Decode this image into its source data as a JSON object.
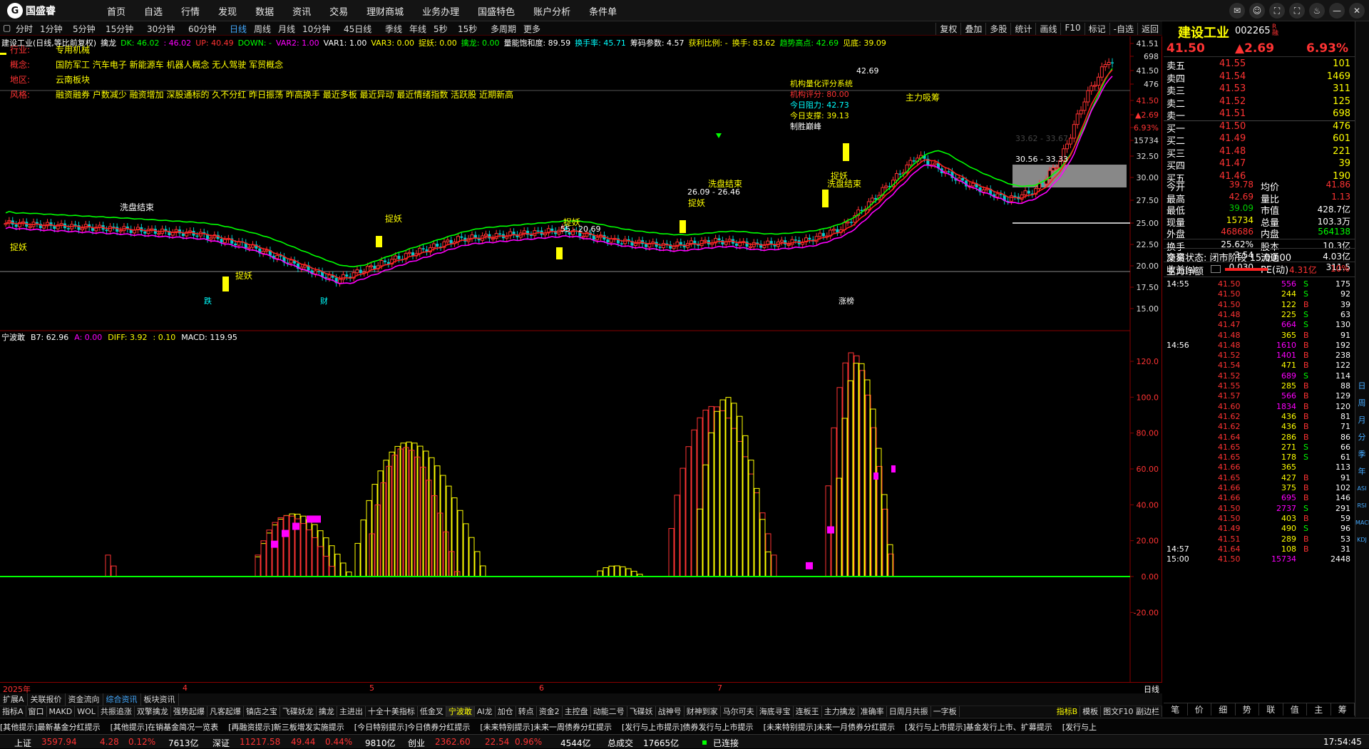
{
  "app": {
    "name": "国盛睿",
    "menu": [
      "首页",
      "自选",
      "行情",
      "发现",
      "数据",
      "资讯",
      "交易",
      "理财商城",
      "业务办理",
      "国盛特色",
      "账户分析",
      "条件单"
    ]
  },
  "window_icons": [
    "message-icon",
    "user-icon",
    "fullscreen-icon",
    "fullscreen-icon",
    "skin-icon",
    "minimize-icon",
    "close-icon"
  ],
  "periods": [
    "分时",
    "1分钟",
    "5分钟",
    "15分钟",
    "30分钟",
    "60分钟",
    "日线",
    "周线",
    "月线",
    "10分钟",
    "45日线",
    "季线",
    "年线",
    "5秒",
    "15秒",
    "多周期",
    "更多"
  ],
  "active_period": "日线",
  "tools": [
    "复权",
    "叠加",
    "多股",
    "统计",
    "画线",
    "F10",
    "标记",
    "-自选",
    "返回"
  ],
  "ind1": [
    {
      "t": "建设工业(日线,等比前复权)",
      "c": "#fff"
    },
    {
      "t": "擒龙",
      "c": "#fff"
    },
    {
      "t": "DK: 46.02",
      "c": "#0f0"
    },
    {
      "t": ": 46.02",
      "c": "#f0f"
    },
    {
      "t": "UP: 40.49",
      "c": "#f33"
    },
    {
      "t": "DOWN: -",
      "c": "#0f0"
    },
    {
      "t": "VAR2: 1.00",
      "c": "#f0f"
    },
    {
      "t": "VAR1: 1.00",
      "c": "#fff"
    },
    {
      "t": "VAR3: 0.00",
      "c": "#ff0"
    },
    {
      "t": "捉妖: 0.00",
      "c": "#ff0"
    },
    {
      "t": "擒龙: 0.00",
      "c": "#0f0"
    },
    {
      "t": "量能饱和度: 89.59",
      "c": "#fff"
    },
    {
      "t": "换手率: 45.71",
      "c": "#0ff"
    },
    {
      "t": "筹码参数: 4.57",
      "c": "#fff"
    },
    {
      "t": "获利比例: -",
      "c": "#ff0"
    },
    {
      "t": "换手: 83.62",
      "c": "#ff0"
    },
    {
      "t": "趋势高点: 42.69",
      "c": "#0f0"
    },
    {
      "t": "见底: 39.09",
      "c": "#ff0"
    }
  ],
  "info": [
    {
      "k": "行业:",
      "v": "专用机械"
    },
    {
      "k": "概念:",
      "v": "国防军工 汽车电子 新能源车 机器人概念 无人驾驶 军贸概念"
    },
    {
      "k": "地区:",
      "v": "云南板块"
    },
    {
      "k": "风格:",
      "v": "融资融券 户数减少 融资增加 深股通标的 久不分红 昨日振荡 昨高换手 最近多板 最近异动 最近情绪指数 活跃股 近期新高"
    }
  ],
  "eval": {
    "title": "机构量化评分系统",
    "score_label": "机构评分: 80.00",
    "resist_label": "今日阻力: 42.73",
    "support_label": "今日支撑: 39.13",
    "peak_label": "制胜巅峰"
  },
  "price_axis": [
    "41.51",
    "698",
    "41.50",
    "476",
    "41.50",
    "▲2.69",
    "6.93%",
    "15734",
    "32.50",
    "30.00",
    "27.50",
    "25.00",
    "22.50",
    "20.00",
    "17.50",
    "15.00"
  ],
  "macd_axis": [
    "120.0",
    "100.0",
    "80.00",
    "60.00",
    "40.00",
    "20.00",
    "0.00",
    "-20.00"
  ],
  "chart_labels": {
    "zhuoyao": "捉妖",
    "xipan": "洗盘结束",
    "zhuli": "主力吸筹",
    "die": "跌",
    "cai": "财",
    "zhangting": "涨榜",
    "rng1": "33.62 - 33.67",
    "rng2": "30.56 - 33.33",
    "rng3": "26.09 - 26.46",
    "rng4": "55 - 20.69",
    "hi": "42.69"
  },
  "ind2": [
    {
      "t": "宁波敢",
      "c": "#fff"
    },
    {
      "t": "B7: 62.96",
      "c": "#fff"
    },
    {
      "t": "A: 0.00",
      "c": "#f0f"
    },
    {
      "t": "DIFF: 3.92",
      "c": "#ff0"
    },
    {
      "t": ": 0.10",
      "c": "#ff0"
    },
    {
      "t": "MACD: 119.95",
      "c": "#fff"
    }
  ],
  "xaxis": [
    "2025年",
    "4",
    "5",
    "6",
    "7"
  ],
  "tabsA": [
    "扩展A",
    "关联报价",
    "资金流向",
    "综合资讯",
    "板块资讯"
  ],
  "tabsA_active": "综合资讯",
  "tabsB": [
    "指标A",
    "窗口",
    "MAKD",
    "WOL",
    "共振追涨",
    "双擎擒龙",
    "强势起爆",
    "凡客起爆",
    "镇店之宝",
    "飞碟妖龙",
    "擒龙",
    "主进出",
    "十全十美指标",
    "低金叉",
    "宁波敢",
    "AI龙",
    "加仓",
    "转点",
    "资金2",
    "主控盘",
    "动能二号",
    "飞碟妖",
    "战神号",
    "财神到家",
    "马尔可夫",
    "海底寻宝",
    "连板王",
    "主力擒龙",
    "准确率",
    "日周月共振",
    "一字板"
  ],
  "tabsB_active": "宁波敢",
  "tabsB_right": [
    "指标B",
    "模板",
    "图文F10 副边栏"
  ],
  "ticker": [
    "[其他提示]最新基金分红提示",
    "[其他提示]在销基金简况一览表",
    "[再融资提示]新三板增发实施提示",
    "[今日特别提示]今日债券分红提示",
    "[未来特别提示]未来一周债券分红提示",
    "[发行与上市提示]债券发行与上市提示",
    "[未来特别提示]未来一月债券分红提示",
    "[发行与上市提示]基金发行上市、扩募提示",
    "[发行与上"
  ],
  "status": {
    "sh_label": "上证",
    "sh_val": "3597.94",
    "sh_chg": "4.28",
    "sh_pct": "0.12%",
    "sh_amt": "7613亿",
    "sz_label": "深证",
    "sz_val": "11217.58",
    "sz_chg": "49.44",
    "sz_pct": "0.44%",
    "sz_amt": "9810亿",
    "cy_label": "创业",
    "cy_val": "2362.60",
    "cy_chg": "22.54",
    "cy_pct": "0.96%",
    "cy_amt": "4544亿",
    "total_label": "总成交",
    "total_amt": "17665亿",
    "conn": "已连接",
    "time": "17:54:45"
  },
  "quote": {
    "name": "建设工业",
    "code": "002265",
    "price": "41.50",
    "change": "▲2.69",
    "pct": "6.93%",
    "asks": [
      [
        "卖五",
        "41.55",
        "101"
      ],
      [
        "卖四",
        "41.54",
        "1469"
      ],
      [
        "卖三",
        "41.53",
        "311"
      ],
      [
        "卖二",
        "41.52",
        "125"
      ],
      [
        "卖一",
        "41.51",
        "698"
      ]
    ],
    "bids": [
      [
        "买一",
        "41.50",
        "476"
      ],
      [
        "买二",
        "41.49",
        "601"
      ],
      [
        "买三",
        "41.48",
        "221"
      ],
      [
        "买四",
        "41.47",
        "39"
      ],
      [
        "买五",
        "41.46",
        "190"
      ]
    ],
    "stats": [
      [
        "今开",
        "39.78",
        "均价",
        "41.86"
      ],
      [
        "最高",
        "42.69",
        "量比",
        "1.13"
      ],
      [
        "最低",
        "39.09",
        "市值",
        "428.7亿"
      ],
      [
        "现量",
        "15734",
        "总量",
        "103.3万"
      ],
      [
        "外盘",
        "468686",
        "内盘",
        "564138"
      ],
      [
        "换手",
        "25.62%",
        "股本",
        "10.3亿"
      ],
      [
        "净资",
        "3.54",
        "流通",
        "4.03亿"
      ],
      [
        "收益(-)",
        "0.030",
        "PE(动)",
        "311.5"
      ]
    ],
    "trade_state": "交易状态: 闭市阶段 15:00:00",
    "main_net_label": "主力净额",
    "main_net": "4.31亿",
    "main_net_pct": "10%"
  },
  "ticks": [
    [
      "14:55",
      "41.50",
      "556",
      "S",
      "175"
    ],
    [
      "",
      "41.50",
      "244",
      "S",
      "92"
    ],
    [
      "",
      "41.50",
      "122",
      "B",
      "39"
    ],
    [
      "",
      "41.48",
      "225",
      "S",
      "63"
    ],
    [
      "",
      "41.47",
      "664",
      "S",
      "130"
    ],
    [
      "",
      "41.48",
      "365",
      "B",
      "91"
    ],
    [
      "14:56",
      "41.48",
      "1610",
      "B",
      "192"
    ],
    [
      "",
      "41.52",
      "1401",
      "B",
      "238"
    ],
    [
      "",
      "41.54",
      "471",
      "B",
      "122"
    ],
    [
      "",
      "41.52",
      "689",
      "S",
      "114"
    ],
    [
      "",
      "41.55",
      "285",
      "B",
      "88"
    ],
    [
      "",
      "41.57",
      "566",
      "B",
      "129"
    ],
    [
      "",
      "41.60",
      "1834",
      "B",
      "120"
    ],
    [
      "",
      "41.62",
      "436",
      "B",
      "81"
    ],
    [
      "",
      "41.62",
      "436",
      "B",
      "71"
    ],
    [
      "",
      "41.64",
      "286",
      "B",
      "86"
    ],
    [
      "",
      "41.65",
      "271",
      "S",
      "66"
    ],
    [
      "",
      "41.65",
      "178",
      "S",
      "61"
    ],
    [
      "",
      "41.66",
      "365",
      "",
      "113"
    ],
    [
      "",
      "41.65",
      "427",
      "B",
      "91"
    ],
    [
      "",
      "41.66",
      "375",
      "B",
      "102"
    ],
    [
      "",
      "41.66",
      "695",
      "B",
      "146"
    ],
    [
      "",
      "41.50",
      "2737",
      "S",
      "291"
    ],
    [
      "",
      "41.50",
      "403",
      "B",
      "59"
    ],
    [
      "",
      "41.49",
      "490",
      "S",
      "96"
    ],
    [
      "",
      "41.51",
      "289",
      "B",
      "53"
    ],
    [
      "14:57",
      "41.64",
      "108",
      "B",
      "31"
    ],
    [
      "15:00",
      "41.50",
      "15734",
      "",
      "2448"
    ]
  ],
  "rp_tabs": [
    "笔",
    "价",
    "细",
    "势",
    "联",
    "值",
    "主",
    "筹"
  ],
  "side_strip": [
    "日",
    "周",
    "月",
    "分",
    "季",
    "年",
    "ASI",
    "RSI",
    "MACD",
    "KDJ"
  ],
  "colors": {
    "up": "#ff3333",
    "down": "#00cccc",
    "ma_green": "#00ff00",
    "ma_red": "#ff2020",
    "ma_magenta": "#ff00ff",
    "yellow": "#ffff00"
  }
}
